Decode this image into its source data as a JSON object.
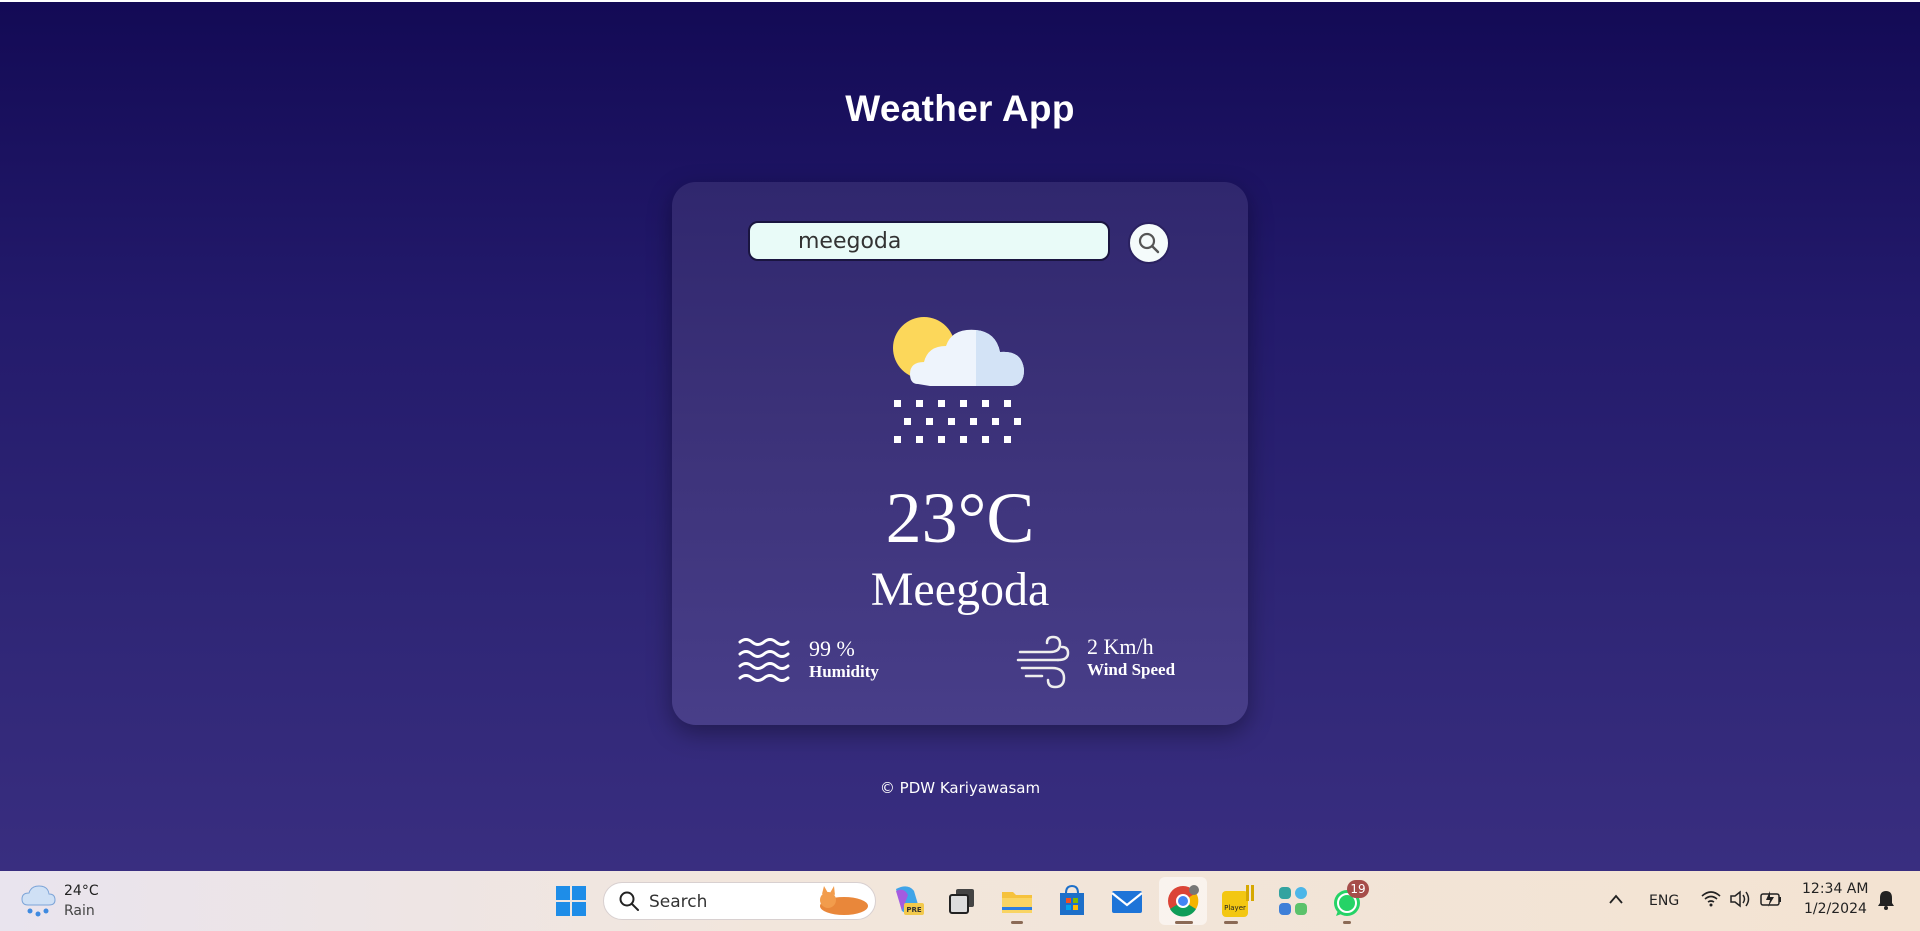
{
  "app": {
    "title": "Weather App",
    "search": {
      "value": "meegoda",
      "placeholder": ""
    },
    "temperature": "23°C",
    "city": "Meegoda",
    "humidity": {
      "value": "99 %",
      "label": "Humidity"
    },
    "wind": {
      "value": "2 Km/h",
      "label": "Wind Speed"
    },
    "weather_icon": "snow-cloud-sun-icon",
    "footer": "© PDW Kariyawasam"
  },
  "taskbar": {
    "weather": {
      "temp": "24°C",
      "condition": "Rain"
    },
    "search_placeholder": "Search",
    "pinned_apps": [
      "copilot",
      "task-view",
      "file-explorer",
      "microsoft-store",
      "mail",
      "chrome",
      "player",
      "app-grid",
      "whatsapp"
    ],
    "whatsapp_badge": "19",
    "pre_badge": "PRE",
    "player_label": "Player",
    "language": "ENG",
    "time": "12:34 AM",
    "date": "1/2/2024"
  },
  "colors": {
    "background_top": "#130a55",
    "background_bottom": "#392e80",
    "card": "#3c3279",
    "input_bg": "#e9fbf8",
    "sun": "#fcd75a",
    "cloud": "#e6f1fb"
  }
}
